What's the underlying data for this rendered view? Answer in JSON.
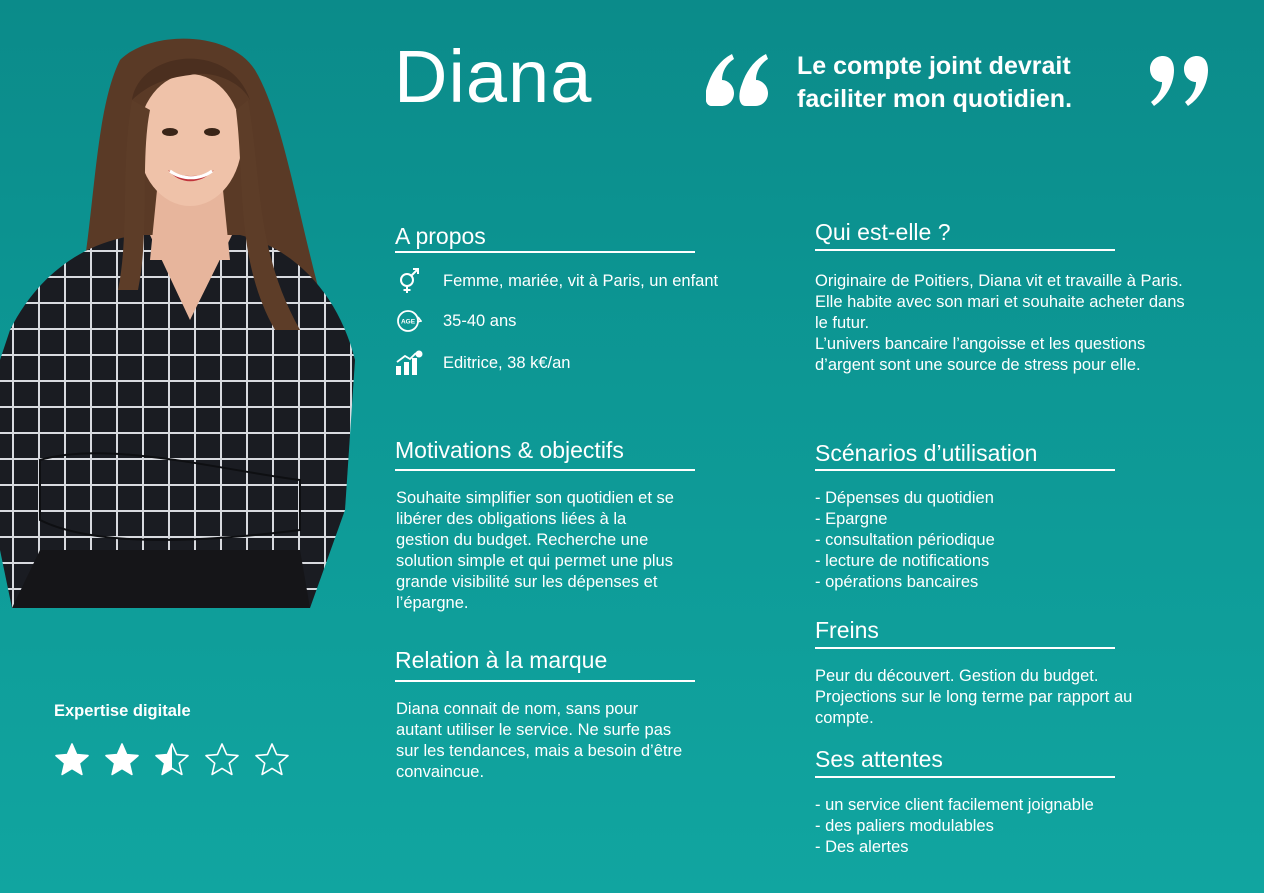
{
  "persona": {
    "name": "Diana",
    "quote": "Le compte joint devrait faciliter mon quotidien."
  },
  "about": {
    "title": "A propos",
    "items": [
      {
        "icon": "gender-icon",
        "text": "Femme, mariée, vit à Paris, un enfant"
      },
      {
        "icon": "age-icon",
        "text": "35-40 ans",
        "icon_label": "AGE"
      },
      {
        "icon": "income-chart-icon",
        "text": "Editrice, 38 k€/an"
      }
    ]
  },
  "who": {
    "title": "Qui est-elle ?",
    "lines": [
      "Originaire de Poitiers, Diana vit et travaille à Paris.",
      "Elle habite avec son mari et souhaite acheter dans",
      "le futur.",
      "L’univers bancaire l’angoisse et les questions",
      "d’argent sont une source de stress pour elle."
    ]
  },
  "motivations": {
    "title": "Motivations & objectifs",
    "lines": [
      "Souhaite simplifier son quotidien et se",
      "libérer des obligations liées à la",
      "gestion du budget. Recherche une",
      "solution simple et qui permet une plus",
      "grande visibilité sur les dépenses et",
      "l’épargne."
    ]
  },
  "scenarios": {
    "title": "Scénarios d’utilisation",
    "items": [
      "- Dépenses du quotidien",
      "- Epargne",
      "- consultation périodique",
      "- lecture de notifications",
      "- opérations bancaires"
    ]
  },
  "brand": {
    "title": "Relation à la marque",
    "lines": [
      "Diana connait de nom, sans pour",
      "autant utiliser le service. Ne surfe pas",
      "sur les tendances, mais a besoin d’être",
      "convaincue."
    ]
  },
  "brakes": {
    "title": "Freins",
    "lines": [
      "Peur du découvert. Gestion du budget.",
      "Projections sur le long terme par rapport au",
      "compte."
    ]
  },
  "expectations": {
    "title": "Ses attentes",
    "items": [
      "- un service client facilement joignable",
      "- des paliers modulables",
      "- Des alertes"
    ]
  },
  "expertise": {
    "label": "Expertise digitale",
    "rating": 2.5,
    "max": 5
  },
  "colors": {
    "background_top": "#0b8b8a",
    "background_bottom": "#11a5a0",
    "text": "#ffffff"
  }
}
